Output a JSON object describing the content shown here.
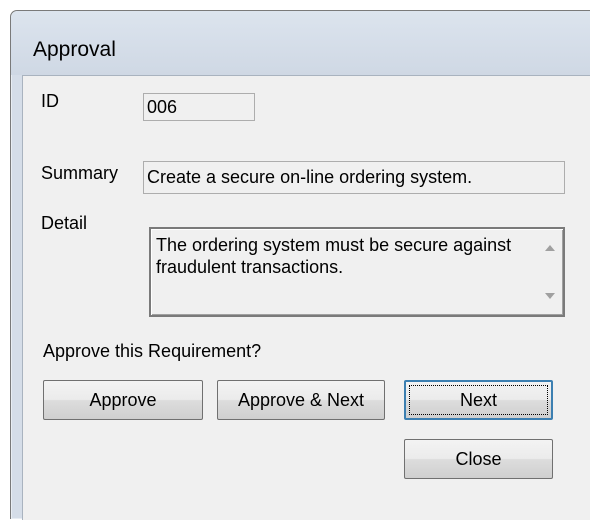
{
  "window": {
    "title": "Approval"
  },
  "form": {
    "id_label": "ID",
    "id_value": "006",
    "summary_label": "Summary",
    "summary_value": "Create a secure on-line ordering system.",
    "detail_label": "Detail",
    "detail_value": "The ordering system must be secure against fraudulent transactions.",
    "prompt": "Approve this Requirement?"
  },
  "buttons": {
    "approve": "Approve",
    "approve_next": "Approve & Next",
    "next": "Next",
    "close": "Close"
  },
  "icons": {
    "scroll_up": "scroll-up-arrow-icon",
    "scroll_down": "scroll-down-arrow-icon"
  }
}
